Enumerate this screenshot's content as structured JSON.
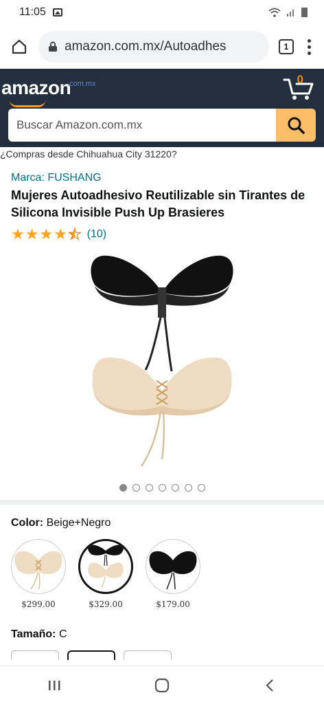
{
  "status_bar": {
    "time": "11:05"
  },
  "browser": {
    "url": "amazon.com.mx/Autoadhes",
    "tab_count": "1"
  },
  "header": {
    "logo_text": "amazon",
    "logo_domain": ".com.mx",
    "cart_count": "0",
    "search_placeholder": "Buscar Amazon.com.mx"
  },
  "delivery_text": "¿Compras desde Chihuahua City 31220?",
  "product": {
    "brand": "Marca: FUSHANG",
    "title": "Mujeres Autoadhesivo Reutilizable sin Tirantes de Silicona Invisible Push Up Brasieres",
    "rating_value": 4.5,
    "rating_count": "(10)",
    "image_count": 7,
    "active_image": 1
  },
  "color": {
    "label": "Color:",
    "value": "Beige+Negro",
    "swatches": [
      {
        "name": "beige",
        "price": "$299.00",
        "selected": false
      },
      {
        "name": "beige-negro",
        "price": "$329.00",
        "selected": true
      },
      {
        "name": "negro",
        "price": "$179.00",
        "selected": false
      }
    ]
  },
  "size": {
    "label": "Tamaño:",
    "value": "C"
  },
  "colors": {
    "header_bg": "#232f3e",
    "search_button": "#febd69",
    "link": "#007185",
    "star": "#ffa41c",
    "cart": "#f08804"
  }
}
